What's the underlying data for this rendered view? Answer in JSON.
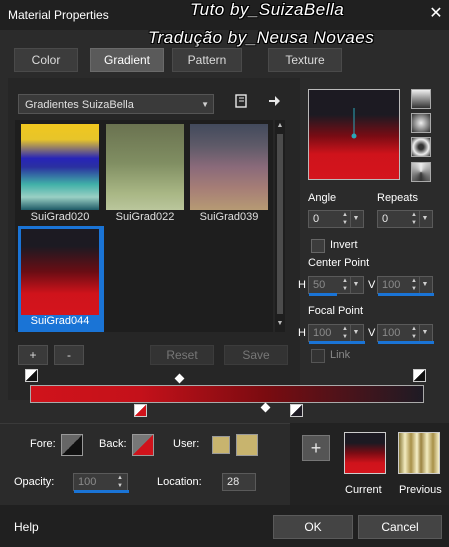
{
  "window": {
    "title": "Material Properties",
    "close_symbol": "✕"
  },
  "watermark": {
    "line1": "Tuto by_SuizaBella",
    "line2": "Tradução by_Neusa Novaes"
  },
  "tabs": [
    {
      "label": "Color",
      "active": false
    },
    {
      "label": "Gradient",
      "active": true
    },
    {
      "label": "Pattern",
      "active": false
    },
    {
      "label": "Texture",
      "active": false
    }
  ],
  "gradient_library": {
    "selected_folder": "Gradientes SuizaBella",
    "items": [
      {
        "label": "SuiGrad020",
        "selected": false
      },
      {
        "label": "SuiGrad022",
        "selected": false
      },
      {
        "label": "SuiGrad039",
        "selected": false
      },
      {
        "label": "SuiGrad044",
        "selected": true
      }
    ]
  },
  "buttons": {
    "add": "+",
    "remove": "-",
    "reset": "Reset",
    "save": "Save",
    "add_to_swatches": "+",
    "help": "Help",
    "ok": "OK",
    "cancel": "Cancel"
  },
  "settings": {
    "angle_label": "Angle",
    "angle_value": "0",
    "repeats_label": "Repeats",
    "repeats_value": "0",
    "invert_label": "Invert",
    "invert_checked": false,
    "center_point_label": "Center Point",
    "center_h_label": "H",
    "center_h_value": "50",
    "center_v_label": "V",
    "center_v_value": "100",
    "focal_point_label": "Focal Point",
    "focal_h_label": "H",
    "focal_h_value": "100",
    "focal_v_label": "V",
    "focal_v_value": "100",
    "link_label": "Link",
    "link_checked": false
  },
  "editor": {
    "fore_label": "Fore:",
    "back_label": "Back:",
    "user_label": "User:",
    "opacity_label": "Opacity:",
    "opacity_value": "100",
    "location_label": "Location:",
    "location_value": "28",
    "current_label": "Current",
    "previous_label": "Previous"
  },
  "colors": {
    "accent": "#1a74d6",
    "gradient_red": "#d0131b",
    "gradient_black": "#1e1b24",
    "user_swatch": "#c8b46e"
  }
}
